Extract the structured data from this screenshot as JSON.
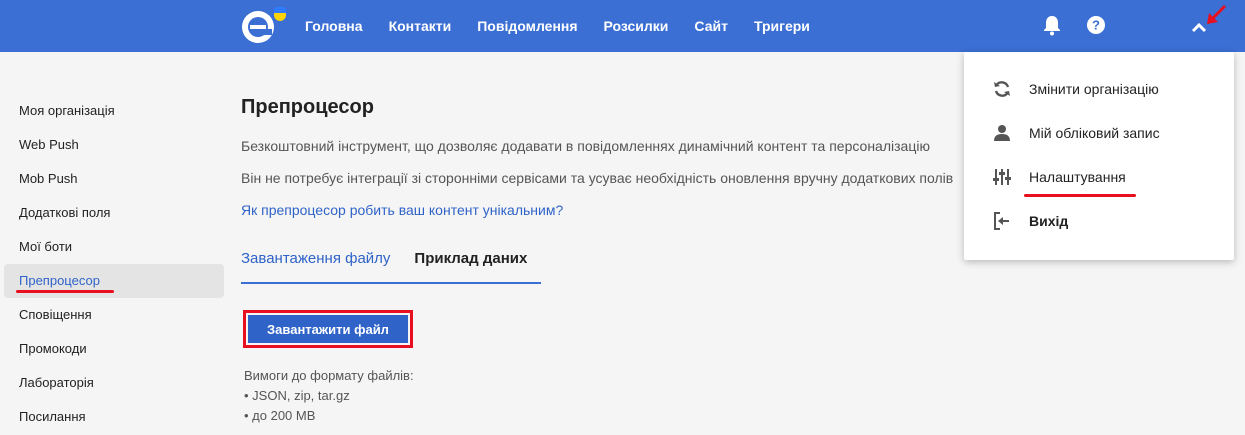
{
  "header": {
    "nav": [
      "Головна",
      "Контакти",
      "Повідомлення",
      "Розсилки",
      "Сайт",
      "Тригери"
    ]
  },
  "sidebar": {
    "items": [
      {
        "label": "Моя організація"
      },
      {
        "label": "Web Push"
      },
      {
        "label": "Mob Push"
      },
      {
        "label": "Додаткові поля"
      },
      {
        "label": "Мої боти"
      },
      {
        "label": "Препроцесор",
        "active": true
      },
      {
        "label": "Сповіщення"
      },
      {
        "label": "Промокоди"
      },
      {
        "label": "Лабораторія"
      },
      {
        "label": "Посилання"
      }
    ]
  },
  "main": {
    "title": "Препроцесор",
    "desc1": "Безкоштовний інструмент, що дозволяє додавати в повідомленнях динамічний контент та персоналізацію",
    "desc2": "Він не потребує інтеграції зі сторонніми сервісами та усуває необхідність оновлення вручну додаткових полів",
    "link": "Як препроцесор робить ваш контент унікальним?",
    "tabs": [
      "Завантаження файлу",
      "Приклад даних"
    ],
    "upload_button": "Завантажити файл",
    "requirements_title": "Вимоги до формату файлів:",
    "requirements": [
      "JSON, zip, tar.gz",
      "до 200 MB"
    ]
  },
  "dropdown": {
    "items": [
      {
        "label": "Змінити організацію",
        "icon": "refresh-icon"
      },
      {
        "label": "Мій обліковий запис",
        "icon": "user-icon"
      },
      {
        "label": "Налаштування",
        "icon": "sliders-icon"
      },
      {
        "label": "Вихід",
        "icon": "logout-icon"
      }
    ]
  },
  "colors": {
    "header": "#3b6fd4",
    "accent": "#2f63c8",
    "highlight": "#e8101e"
  }
}
